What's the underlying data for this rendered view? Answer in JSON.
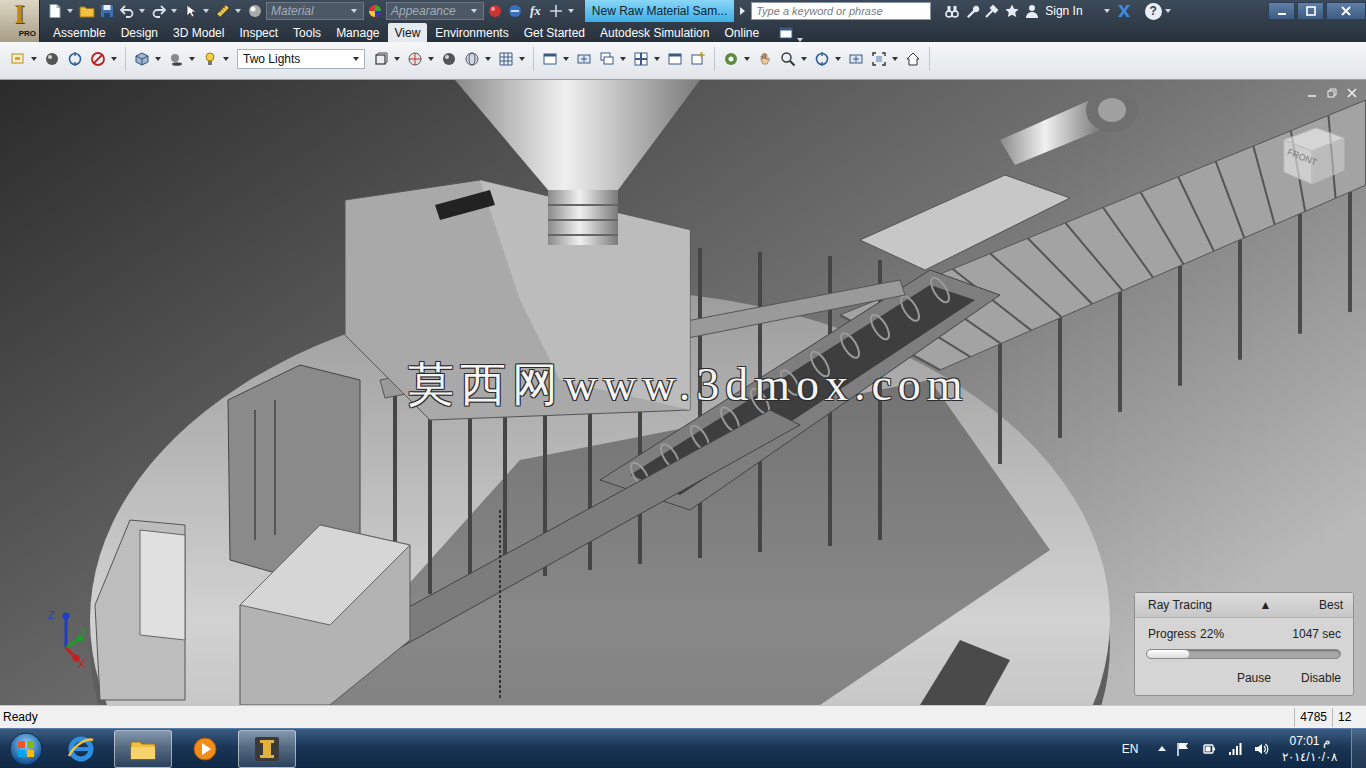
{
  "app": {
    "logo": "I",
    "edition": "PRO"
  },
  "quick_access": {
    "material": "Material",
    "appearance": "Appearance",
    "formula": "fx"
  },
  "document_tab": {
    "title": "New Raw Material Sam...",
    "selected": true
  },
  "search": {
    "placeholder": "Type a keyword or phrase"
  },
  "account": {
    "sign_in": "Sign In"
  },
  "help": {
    "label": "?"
  },
  "ribbon_tabs": [
    {
      "label": "Assemble",
      "selected": false
    },
    {
      "label": "Design",
      "selected": false
    },
    {
      "label": "3D Model",
      "selected": false
    },
    {
      "label": "Inspect",
      "selected": false
    },
    {
      "label": "Tools",
      "selected": false
    },
    {
      "label": "Manage",
      "selected": false
    },
    {
      "label": "View",
      "selected": true
    },
    {
      "label": "Environments",
      "selected": false
    },
    {
      "label": "Get Started",
      "selected": false
    },
    {
      "label": "Autodesk Simulation",
      "selected": false
    },
    {
      "label": "Online",
      "selected": false
    }
  ],
  "ribbon": {
    "lighting_style": "Two Lights"
  },
  "viewport": {
    "watermark": "莫西网www.3dmox.com",
    "view_cube_face": "FRONT",
    "axes": [
      {
        "label": "Z",
        "color": "#1f3fbf"
      },
      {
        "label": "Y",
        "color": "#1f9a2f"
      },
      {
        "label": "X",
        "color": "#c81e1e"
      }
    ]
  },
  "ray_tracing": {
    "title": "Ray Tracing",
    "toggle": "▲",
    "quality": "Best",
    "progress_label": "Progress",
    "percent": "22%",
    "time": "1047 sec",
    "level": 0.22,
    "buttons": [
      "Pause",
      "Disable"
    ]
  },
  "status_bar": {
    "message": "Ready",
    "count": "4785",
    "extra": "12"
  },
  "taskbar": {
    "apps": [
      {
        "kind": "browser",
        "selected": false
      },
      {
        "kind": "explorer",
        "selected": true
      },
      {
        "kind": "media",
        "selected": false
      },
      {
        "kind": "inventor",
        "selected": true
      }
    ],
    "language": "EN",
    "time": "07:01 م",
    "date": "٢٠١٤/١٠/٠٨"
  }
}
